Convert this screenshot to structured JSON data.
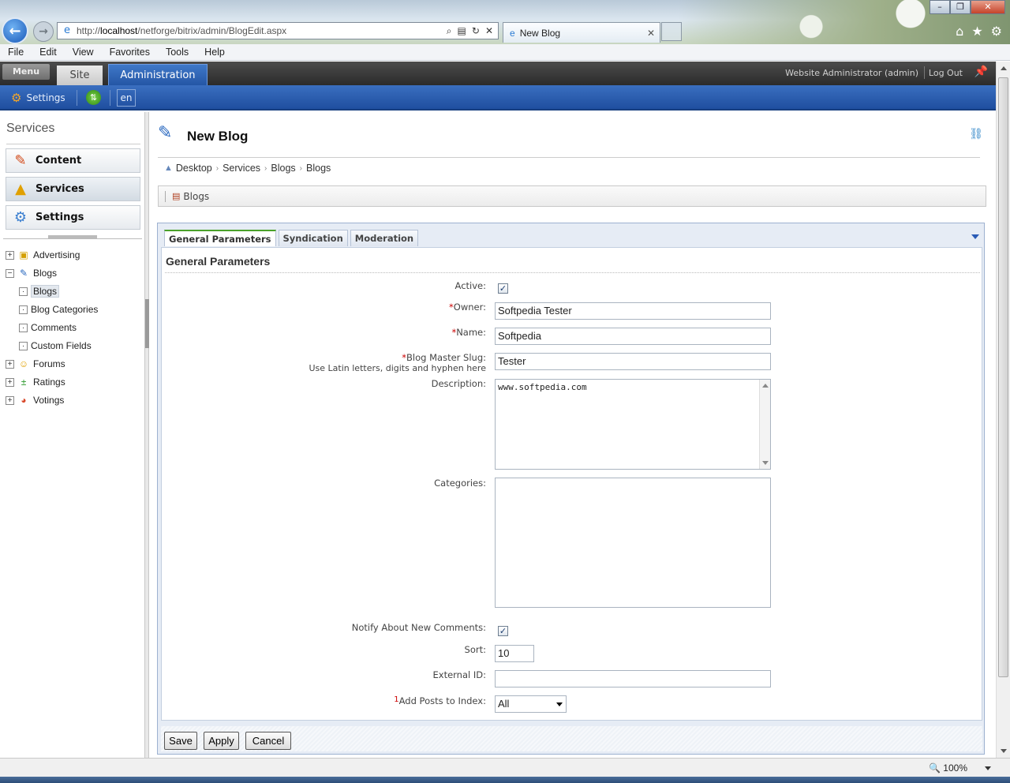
{
  "browser": {
    "url_prefix": "http://",
    "url_host": "localhost",
    "url_path": "/netforge/bitrix/admin/BlogEdit.aspx",
    "tab_title": "New Blog",
    "menu": [
      "File",
      "Edit",
      "View",
      "Favorites",
      "Tools",
      "Help"
    ],
    "zoom": "100%"
  },
  "admin_panel": {
    "menu_label": "Menu",
    "site_tab": "Site",
    "admin_tab": "Administration",
    "user": "Website Administrator (admin)",
    "logout": "Log Out",
    "settings_label": "Settings",
    "lang": "en"
  },
  "sidebar": {
    "title": "Services",
    "buttons": [
      {
        "label": "Content",
        "icon": "pencil-document-icon"
      },
      {
        "label": "Services",
        "icon": "shapes-icon"
      },
      {
        "label": "Settings",
        "icon": "gear-icon"
      }
    ],
    "tree": [
      {
        "label": "Advertising",
        "expander": "+"
      },
      {
        "label": "Blogs",
        "expander": "−"
      },
      {
        "label": "Blogs",
        "selected": true
      },
      {
        "label": "Blog Categories"
      },
      {
        "label": "Comments"
      },
      {
        "label": "Custom Fields"
      },
      {
        "label": "Forums",
        "expander": "+"
      },
      {
        "label": "Ratings",
        "expander": "+"
      },
      {
        "label": "Votings",
        "expander": "+"
      }
    ]
  },
  "page": {
    "title": "New Blog",
    "breadcrumb": [
      "Desktop",
      "Services",
      "Blogs",
      "Blogs"
    ],
    "context_link": "Blogs"
  },
  "tabs": [
    "General Parameters",
    "Syndication",
    "Moderation"
  ],
  "form": {
    "section_title": "General Parameters",
    "active_label": "Active:",
    "active_checked": true,
    "owner_label": "Owner:",
    "owner_value": "Softpedia Tester",
    "name_label": "Name:",
    "name_value": "Softpedia",
    "slug_label": "Blog Master Slug:",
    "slug_hint": "Use Latin letters, digits and hyphen here",
    "slug_value": "Tester",
    "description_label": "Description:",
    "description_value": "www.softpedia.com",
    "categories_label": "Categories:",
    "notify_label": "Notify About New Comments:",
    "notify_checked": true,
    "sort_label": "Sort:",
    "sort_value": "10",
    "external_id_label": "External ID:",
    "external_id_value": "",
    "index_label": "Add Posts to Index:",
    "index_footnote": "1",
    "index_value": "All",
    "required_mark": "*"
  },
  "buttons": {
    "save": "Save",
    "apply": "Apply",
    "cancel": "Cancel"
  }
}
